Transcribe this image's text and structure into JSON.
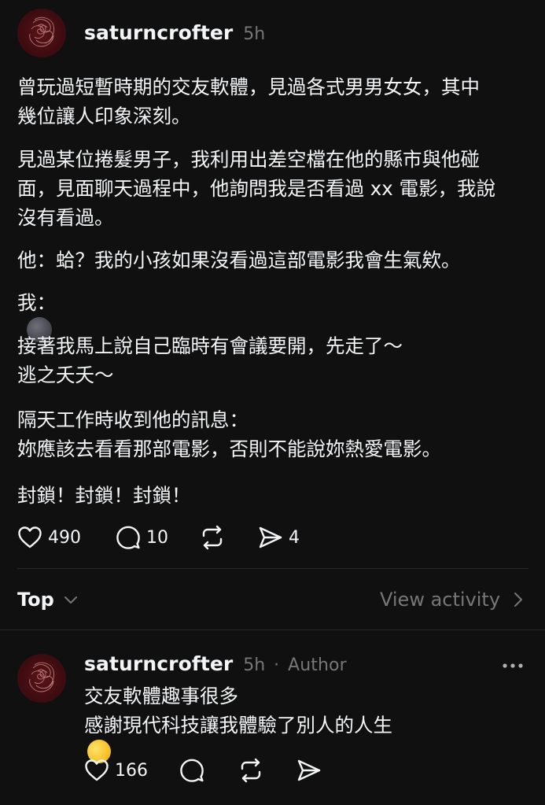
{
  "post": {
    "username": "saturncrofter",
    "time": "5h",
    "paragraphs": [
      [
        "曾玩過短暫時期的交友軟體，見過各式男男女女，其中",
        "幾位讓人印象深刻。"
      ],
      [
        "見過某位捲髮男子，我利用出差空檔在他的縣市與他碰",
        "面，見面聊天過程中，他詢問我是否看過 xx 電影，我說",
        "沒有看過。"
      ],
      [
        "他：蛤？我的小孩如果沒看過這部電影我會生氣欸。"
      ],
      [
        "我："
      ],
      [
        "接著我馬上說自己臨時有會議要開，先走了～",
        "逃之夭夭～"
      ],
      [
        "隔天工作時收到他的訊息：",
        "妳應該去看看那部電影，否則不能說妳熱愛電影。"
      ],
      [
        "封鎖！封鎖！封鎖！"
      ]
    ],
    "emoji": "new-moon-face",
    "actions": {
      "likes": "490",
      "comments": "10",
      "shares": "4"
    }
  },
  "sort": {
    "label": "Top",
    "view_activity": "View activity"
  },
  "reply": {
    "username": "saturncrofter",
    "time": "5h",
    "separator": "·",
    "badge": "Author",
    "lines": [
      "交友軟體趣事很多",
      "感謝現代科技讓我體驗了別人的人生"
    ],
    "emoji": "rolling-on-floor-laughing",
    "actions": {
      "likes": "166"
    }
  },
  "colors": {
    "background": "#101010",
    "text": "#f3f5f7",
    "muted": "#777777",
    "divider": "#2a2a2a",
    "avatar": "#3f0c10"
  }
}
